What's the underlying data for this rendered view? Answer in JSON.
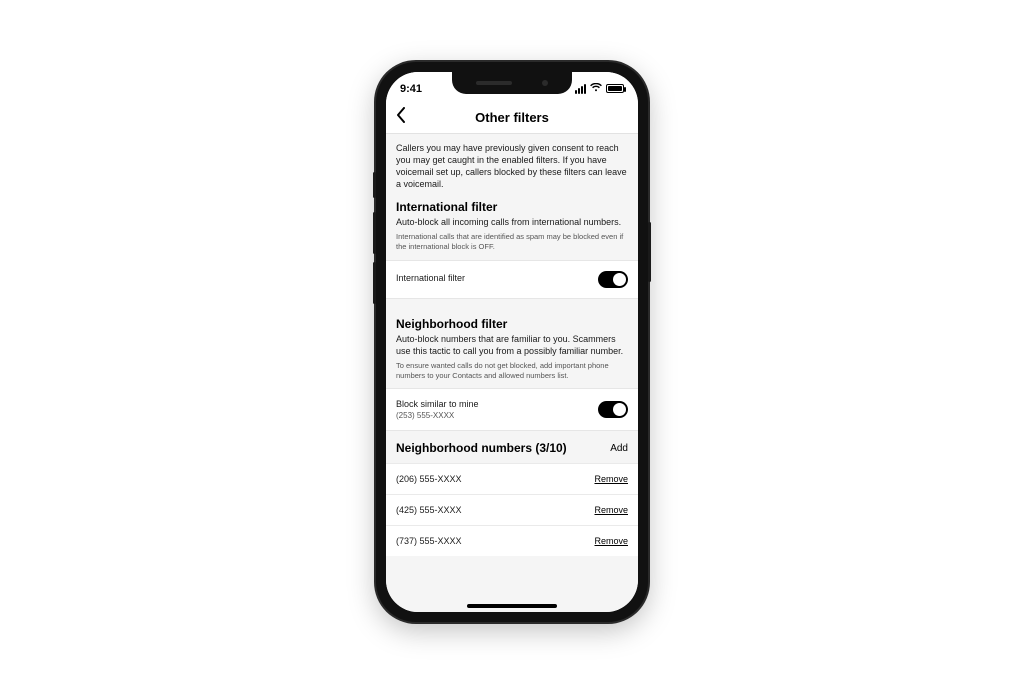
{
  "status": {
    "time": "9:41"
  },
  "nav": {
    "title": "Other filters"
  },
  "intro": "Callers you may have previously given consent to reach you may get caught in the enabled filters. If you have voicemail set up, callers blocked by these filters can leave a voicemail.",
  "international": {
    "heading": "International filter",
    "desc": "Auto-block all incoming calls from international numbers.",
    "fine": "International calls that are identified as spam may be blocked even if the international block is OFF.",
    "toggle_label": "International filter",
    "toggle_on": true
  },
  "neighborhood": {
    "heading": "Neighborhood filter",
    "desc": "Auto-block numbers that are familiar to you. Scammers use this tactic to call you from a possibly familiar number.",
    "fine": "To ensure wanted calls do not get blocked, add important phone numbers to your Contacts and allowed numbers list.",
    "block_label": "Block similar to mine",
    "block_sub": "(253) 555-XXXX",
    "toggle_on": true
  },
  "numbers": {
    "heading": "Neighborhood numbers (3/10)",
    "add_label": "Add",
    "remove_label": "Remove",
    "items": [
      {
        "value": "(206) 555-XXXX"
      },
      {
        "value": "(425) 555-XXXX"
      },
      {
        "value": "(737) 555-XXXX"
      }
    ]
  }
}
